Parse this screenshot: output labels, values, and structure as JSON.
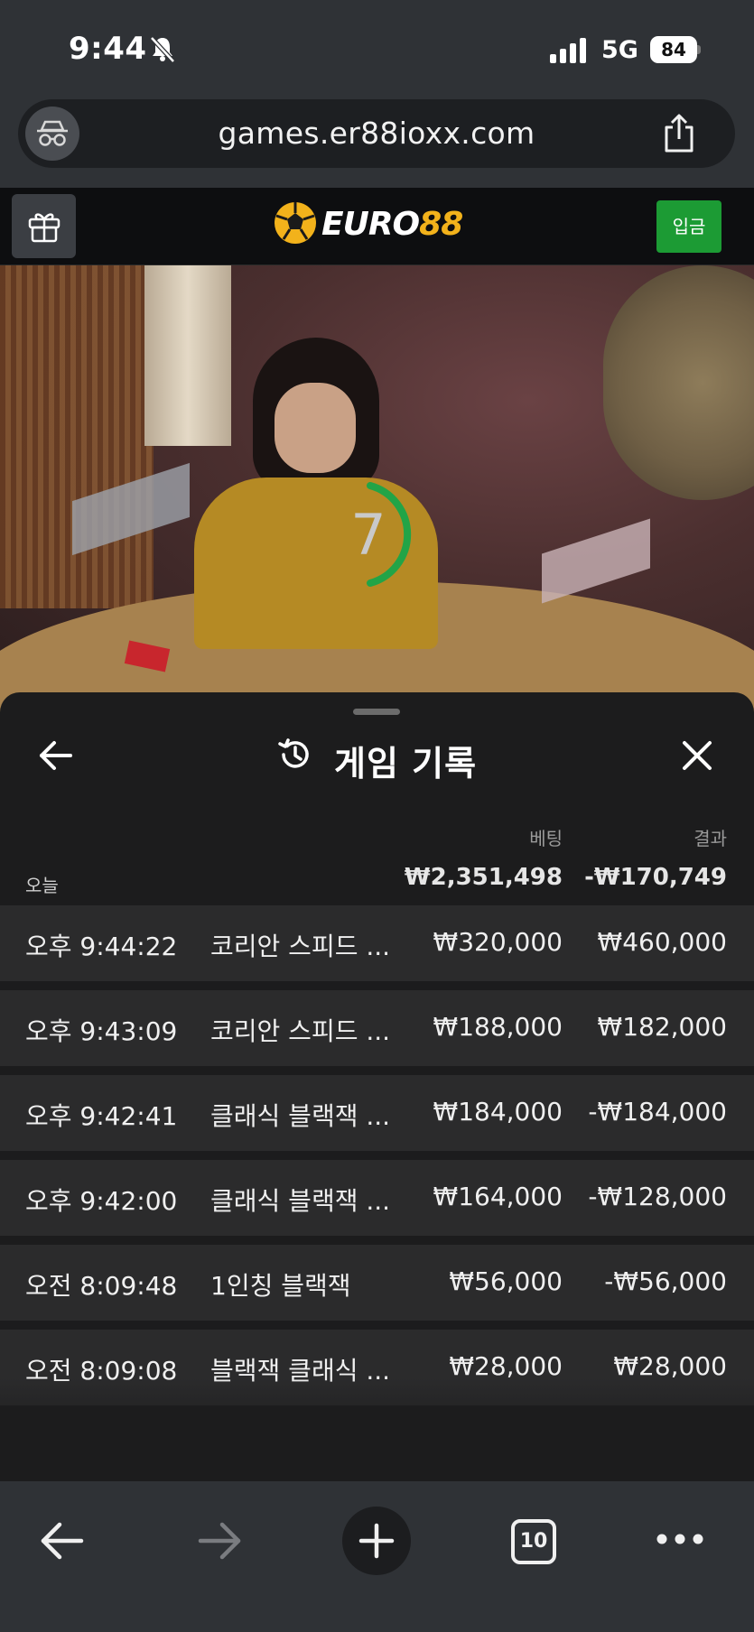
{
  "status": {
    "time": "9:44",
    "network": "5G",
    "battery": "84"
  },
  "browser": {
    "url": "games.er88ioxx.com",
    "open_tabs": "10"
  },
  "site": {
    "logo_word": "EURO",
    "logo_number": "88",
    "deposit_label": "입금",
    "brand_color": "#f2b21b",
    "deposit_color": "#1c9b34"
  },
  "video": {
    "countdown": "7"
  },
  "history": {
    "title": "게임 기록",
    "columns": {
      "bet": "베팅",
      "result": "결과"
    },
    "summary": {
      "label": "오늘",
      "bet_total": "₩2,351,498",
      "result_total": "-₩170,749"
    },
    "rows": [
      {
        "time": "오후 9:44:22",
        "game": "코리안 스피드 ...",
        "bet": "₩320,000",
        "result": "₩460,000"
      },
      {
        "time": "오후 9:43:09",
        "game": "코리안 스피드 ...",
        "bet": "₩188,000",
        "result": "₩182,000"
      },
      {
        "time": "오후 9:42:41",
        "game": "클래식 블랙잭 ...",
        "bet": "₩184,000",
        "result": "-₩184,000"
      },
      {
        "time": "오후 9:42:00",
        "game": "클래식 블랙잭 ...",
        "bet": "₩164,000",
        "result": "-₩128,000"
      },
      {
        "time": "오전 8:09:48",
        "game": "1인칭 블랙잭",
        "bet": "₩56,000",
        "result": "-₩56,000"
      },
      {
        "time": "오전 8:09:08",
        "game": "블랙잭 클래식 ...",
        "bet": "₩28,000",
        "result": "₩28,000"
      }
    ]
  },
  "icons": {
    "status": [
      "bell-slash-icon",
      "signal-icon",
      "battery-icon"
    ],
    "browser": [
      "incognito-icon",
      "share-icon",
      "back-icon",
      "forward-icon",
      "plus-icon",
      "tabs-icon",
      "more-icon"
    ],
    "site": [
      "gift-icon",
      "soccer-ball-icon"
    ],
    "panel": [
      "arrow-left-icon",
      "history-icon",
      "close-icon"
    ]
  }
}
